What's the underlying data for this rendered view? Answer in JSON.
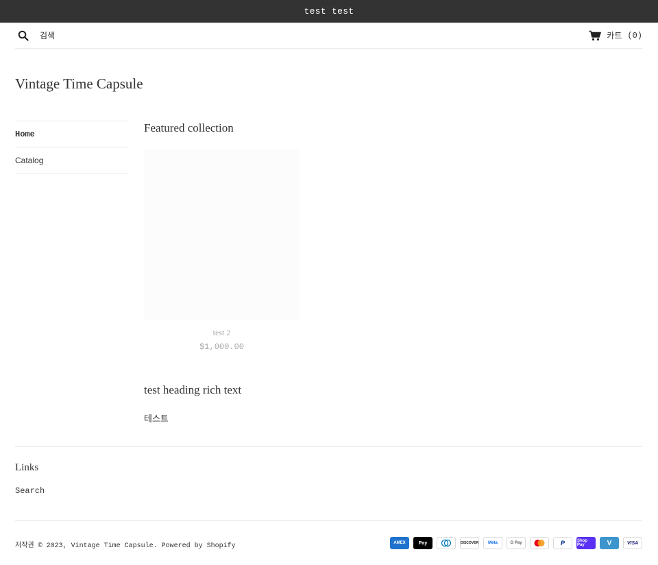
{
  "announcement": {
    "text": "test test"
  },
  "header": {
    "search_label": "검색",
    "cart_label": "카트",
    "cart_count": "(0)"
  },
  "site": {
    "title": "Vintage Time Capsule"
  },
  "nav": {
    "items": [
      {
        "label": "Home",
        "active": true
      },
      {
        "label": "Catalog",
        "active": false
      }
    ]
  },
  "featured": {
    "heading": "Featured collection",
    "products": [
      {
        "title": "test 2",
        "price": "$1,000.00"
      }
    ]
  },
  "rich_text": {
    "heading": "test heading rich text",
    "body": "테스트"
  },
  "footer": {
    "links_heading": "Links",
    "links": [
      {
        "label": "Search"
      }
    ],
    "copyright_prefix": "저작권",
    "copyright_rest": "© 2023, Vintage Time Capsule. Powered by Shopify",
    "payments": [
      {
        "name": "amex-icon",
        "label": "AMEX",
        "bg": "#1f72cd",
        "fg": "#ffffff"
      },
      {
        "name": "apple-pay-icon",
        "label": "Pay",
        "bg": "#000000",
        "fg": "#ffffff"
      },
      {
        "name": "diners-club-icon",
        "label": "D",
        "bg": "#ffffff",
        "fg": "#0079be"
      },
      {
        "name": "discover-icon",
        "label": "DISCOVER",
        "bg": "#ffffff",
        "fg": "#231f20"
      },
      {
        "name": "meta-pay-icon",
        "label": "Meta",
        "bg": "#ffffff",
        "fg": "#0668e1"
      },
      {
        "name": "google-pay-icon",
        "label": "G Pay",
        "bg": "#ffffff",
        "fg": "#5f6368"
      },
      {
        "name": "mastercard-icon",
        "label": "",
        "bg": "#ffffff",
        "fg": "#eb001b"
      },
      {
        "name": "paypal-icon",
        "label": "P",
        "bg": "#ffffff",
        "fg": "#003087"
      },
      {
        "name": "shop-pay-icon",
        "label": "Shop Pay",
        "bg": "#5a31f4",
        "fg": "#ffffff"
      },
      {
        "name": "venmo-icon",
        "label": "V",
        "bg": "#3d95ce",
        "fg": "#ffffff"
      },
      {
        "name": "visa-icon",
        "label": "VISA",
        "bg": "#ffffff",
        "fg": "#1a1f71"
      }
    ]
  },
  "colors": {
    "announcement_bg": "#333333",
    "text": "#333333",
    "muted": "#a8a8a8",
    "border": "#e8e8e8"
  }
}
